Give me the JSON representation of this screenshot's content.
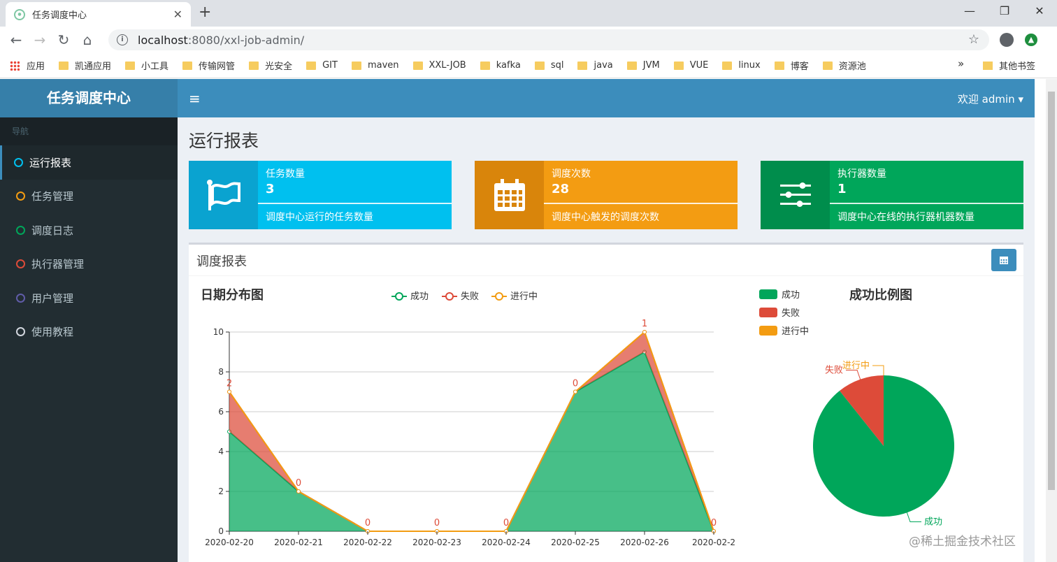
{
  "browser": {
    "tab_title": "任务调度中心",
    "url_host": "localhost",
    "url_rest": ":8080/xxl-job-admin/",
    "bookmarks": [
      "应用",
      "凯通应用",
      "小工具",
      "传输网管",
      "光安全",
      "GIT",
      "maven",
      "XXL-JOB",
      "kafka",
      "sql",
      "java",
      "JVM",
      "VUE",
      "linux",
      "博客",
      "资源池"
    ],
    "other_bookmarks": "其他书签",
    "more": "»"
  },
  "app": {
    "logo": "任务调度中心",
    "welcome": "欢迎 admin",
    "nav_header": "导航",
    "nav_items": [
      {
        "label": "运行报表",
        "color": "#00c0ef"
      },
      {
        "label": "任务管理",
        "color": "#f39c12"
      },
      {
        "label": "调度日志",
        "color": "#00a65a"
      },
      {
        "label": "执行器管理",
        "color": "#dd4b39"
      },
      {
        "label": "用户管理",
        "color": "#605ca8"
      },
      {
        "label": "使用教程",
        "color": "#d2d6de"
      }
    ],
    "page_title": "运行报表",
    "info_boxes": [
      {
        "label": "任务数量",
        "value": "3",
        "desc": "调度中心运行的任务数量",
        "color": "#00c0ef",
        "icon_bg": "#0aa3d0",
        "icon": "flag-icon"
      },
      {
        "label": "调度次数",
        "value": "28",
        "desc": "调度中心触发的调度次数",
        "color": "#f39c12",
        "icon_bg": "#d9850b",
        "icon": "calendar-icon"
      },
      {
        "label": "执行器数量",
        "value": "1",
        "desc": "调度中心在线的执行器机器数量",
        "color": "#00a65a",
        "icon_bg": "#008d4c",
        "icon": "sliders-icon"
      }
    ],
    "report_title": "调度报表"
  },
  "chart_data": [
    {
      "type": "area",
      "title": "日期分布图",
      "categories": [
        "2020-02-20",
        "2020-02-21",
        "2020-02-22",
        "2020-02-23",
        "2020-02-24",
        "2020-02-25",
        "2020-02-26",
        "2020-02-2"
      ],
      "stacked": true,
      "series": [
        {
          "name": "成功",
          "values": [
            5,
            2,
            0,
            0,
            0,
            7,
            9,
            0
          ],
          "color": "#00a65a"
        },
        {
          "name": "失败",
          "values": [
            2,
            0,
            0,
            0,
            0,
            0,
            1,
            0
          ],
          "color": "#dd4b39"
        },
        {
          "name": "进行中",
          "values": [
            0,
            0,
            0,
            0,
            0,
            0,
            0,
            0
          ],
          "color": "#f39c12"
        }
      ],
      "data_labels": [
        "2",
        "0",
        "0",
        "0",
        "0",
        "0",
        "1",
        "0"
      ],
      "yticks": [
        "0",
        "2",
        "4",
        "6",
        "8",
        "10"
      ],
      "ylim": [
        0,
        10
      ],
      "legend_position": "top"
    },
    {
      "type": "pie",
      "title": "成功比例图",
      "series": [
        {
          "name": "成功",
          "value": 25,
          "color": "#00a65a"
        },
        {
          "name": "失败",
          "value": 3,
          "color": "#dd4b39"
        },
        {
          "name": "进行中",
          "value": 0,
          "color": "#f39c12"
        }
      ],
      "legend_position": "left"
    }
  ],
  "watermark": "@稀土掘金技术社区"
}
